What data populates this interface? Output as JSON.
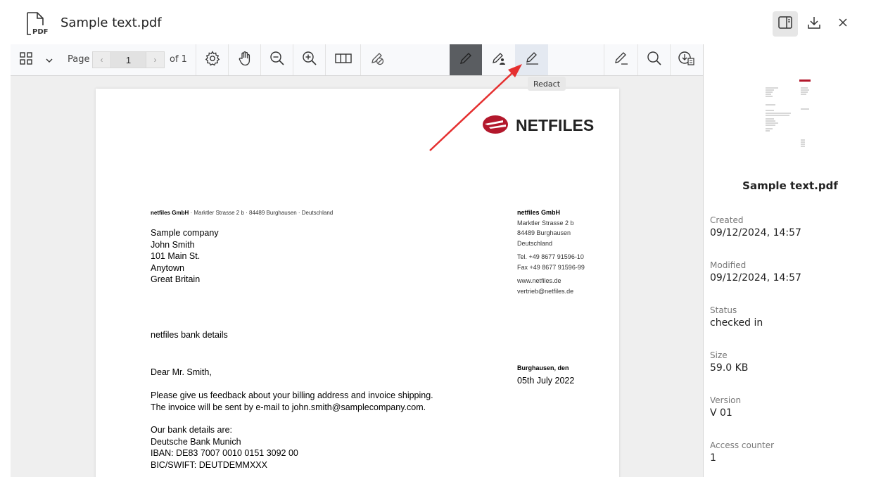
{
  "header": {
    "title": "Sample text.pdf",
    "file_icon_text": "PDF"
  },
  "toolbar": {
    "page_label": "Page",
    "current_page": "1",
    "of_label": "of 1",
    "tooltip": "Redact"
  },
  "document": {
    "sender_line_name": "netfiles GmbH",
    "sender_line_rest": " · Marktler Strasse 2 b · 84489 Burghausen · Deutschland",
    "recipient": [
      "Sample company",
      "John Smith",
      "101 Main St.",
      "Anytown",
      "Great Britain"
    ],
    "company_block": {
      "name": "netfiles GmbH",
      "address": [
        "Marktler Strasse 2 b",
        "84489 Burghausen",
        "Deutschland"
      ],
      "phone": [
        "Tel. +49 8677 91596-10",
        "Fax +49 8677 91596-99"
      ],
      "web": [
        "www.netfiles.de",
        "vertrieb@netfiles.de"
      ]
    },
    "logo_text": "NETFILES",
    "subject": "netfiles bank details",
    "salutation": "Dear Mr. Smith,",
    "place_date_label": "Burghausen, den",
    "date": "05th July 2022",
    "body": [
      "Please give us feedback about your billing address and invoice shipping.",
      "The invoice will be sent by e-mail to john.smith@samplecompany.com."
    ],
    "bank": [
      "Our bank details are:",
      "Deutsche Bank Munich",
      "IBAN: DE83 7007 0010 0151 3092 00",
      "BIC/SWIFT: DEUTDEMMXXX"
    ]
  },
  "sidebar": {
    "title": "Sample text.pdf",
    "meta": [
      {
        "label": "Created",
        "value": "09/12/2024, 14:57"
      },
      {
        "label": "Modified",
        "value": "09/12/2024, 14:57"
      },
      {
        "label": "Status",
        "value": "checked in"
      },
      {
        "label": "Size",
        "value": "59.0 KB"
      },
      {
        "label": "Version",
        "value": "V 01"
      },
      {
        "label": "Access counter",
        "value": "1"
      }
    ]
  },
  "colors": {
    "accent_red": "#b3182c",
    "arrow_red": "#e53030"
  }
}
